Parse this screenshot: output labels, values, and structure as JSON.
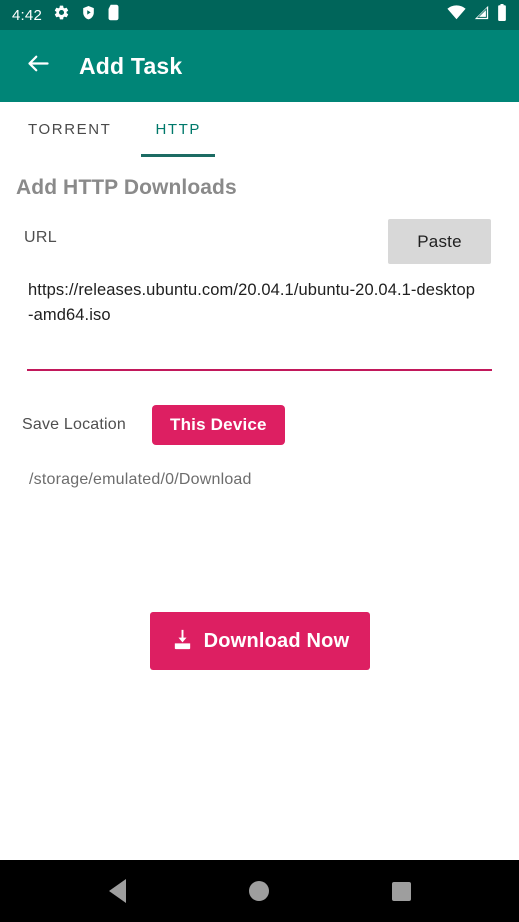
{
  "status_bar": {
    "time": "4:42",
    "icons_left": [
      "gear-icon",
      "shield-play-icon",
      "sd-card-icon"
    ],
    "icons_right": [
      "wifi-icon",
      "cellular-signal-icon",
      "battery-icon"
    ],
    "background_color": "#00655a"
  },
  "app_bar": {
    "back_icon": "arrow-left-icon",
    "title": "Add Task",
    "background_color": "#008577"
  },
  "tabs": [
    {
      "label": "TORRENT",
      "active": false
    },
    {
      "label": "HTTP",
      "active": true
    }
  ],
  "main": {
    "section_title": "Add HTTP Downloads",
    "url_label": "URL",
    "paste_button": "Paste",
    "url_value": "https://releases.ubuntu.com/20.04.1/ubuntu-20.04.1-desktop-amd64.iso",
    "url_placeholder": "URL",
    "save_location_label": "Save Location",
    "save_location_button": "This Device",
    "save_path": "/storage/emulated/0/Download",
    "download_button": "Download Now",
    "download_icon": "download-icon"
  },
  "colors": {
    "accent_teal": "#008577",
    "status_teal": "#00655a",
    "tab_active": "#00796b",
    "tab_indicator": "#1c6b63",
    "pink": "#dd1f62",
    "pink_underline": "#c2185b",
    "paste_grey": "#d8d8d8"
  },
  "nav_bar": {
    "back": "nav-back-icon",
    "home": "nav-home-icon",
    "recents": "nav-recents-icon"
  }
}
